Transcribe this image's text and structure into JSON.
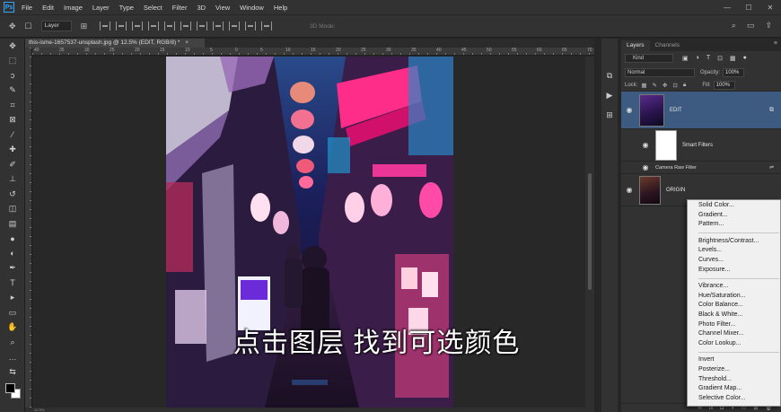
{
  "app": {
    "logo": "Ps"
  },
  "menubar": {
    "items": [
      "File",
      "Edit",
      "Image",
      "Layer",
      "Type",
      "Select",
      "Filter",
      "3D",
      "View",
      "Window",
      "Help"
    ]
  },
  "window_controls": {
    "minimize": "—",
    "maximize": "☐",
    "close": "✕"
  },
  "options_bar": {
    "layer_select": "Layer",
    "mode_3d": "3D Mode:"
  },
  "document": {
    "tab_title": "this-isme-1657537-unsplash.jpg @ 12.5% (EDIT, RGB/8) *",
    "close_glyph": "×"
  },
  "ruler_labels": [
    "40",
    "35",
    "30",
    "25",
    "20",
    "15",
    "10",
    "5",
    "0",
    "5",
    "10",
    "15",
    "20",
    "25",
    "30",
    "35",
    "40",
    "45",
    "50",
    "55",
    "60",
    "65",
    "70"
  ],
  "status": {
    "zoom": "12.5%"
  },
  "overlay": {
    "subtitle": "点击图层 找到可选颜色"
  },
  "layers_panel": {
    "tabs": [
      "Layers",
      "Channels"
    ],
    "kind_label": "Kind",
    "blend_mode": "Normal",
    "opacity_label": "Opacity:",
    "opacity_value": "100%",
    "lock_label": "Lock:",
    "fill_label": "Fill:",
    "fill_value": "100%",
    "layers": [
      {
        "name": "EDIT",
        "selected": true
      },
      {
        "name": "ORIGIN",
        "selected": false
      }
    ],
    "smart_filters_label": "Smart Filters",
    "camera_raw_label": "Camera Raw Filter"
  },
  "adjustment_menu": {
    "groups": [
      [
        "Solid Color...",
        "Gradient...",
        "Pattern..."
      ],
      [
        "Brightness/Contrast...",
        "Levels...",
        "Curves...",
        "Exposure..."
      ],
      [
        "Vibrance...",
        "Hue/Saturation...",
        "Color Balance...",
        "Black & White...",
        "Photo Filter...",
        "Channel Mixer...",
        "Color Lookup..."
      ],
      [
        "Invert",
        "Posterize...",
        "Threshold...",
        "Gradient Map...",
        "Selective Color..."
      ]
    ]
  },
  "colors": {
    "selection": "#3d5a80",
    "accent": "#31a8ff",
    "menu_bg": "#f0f0f0"
  }
}
